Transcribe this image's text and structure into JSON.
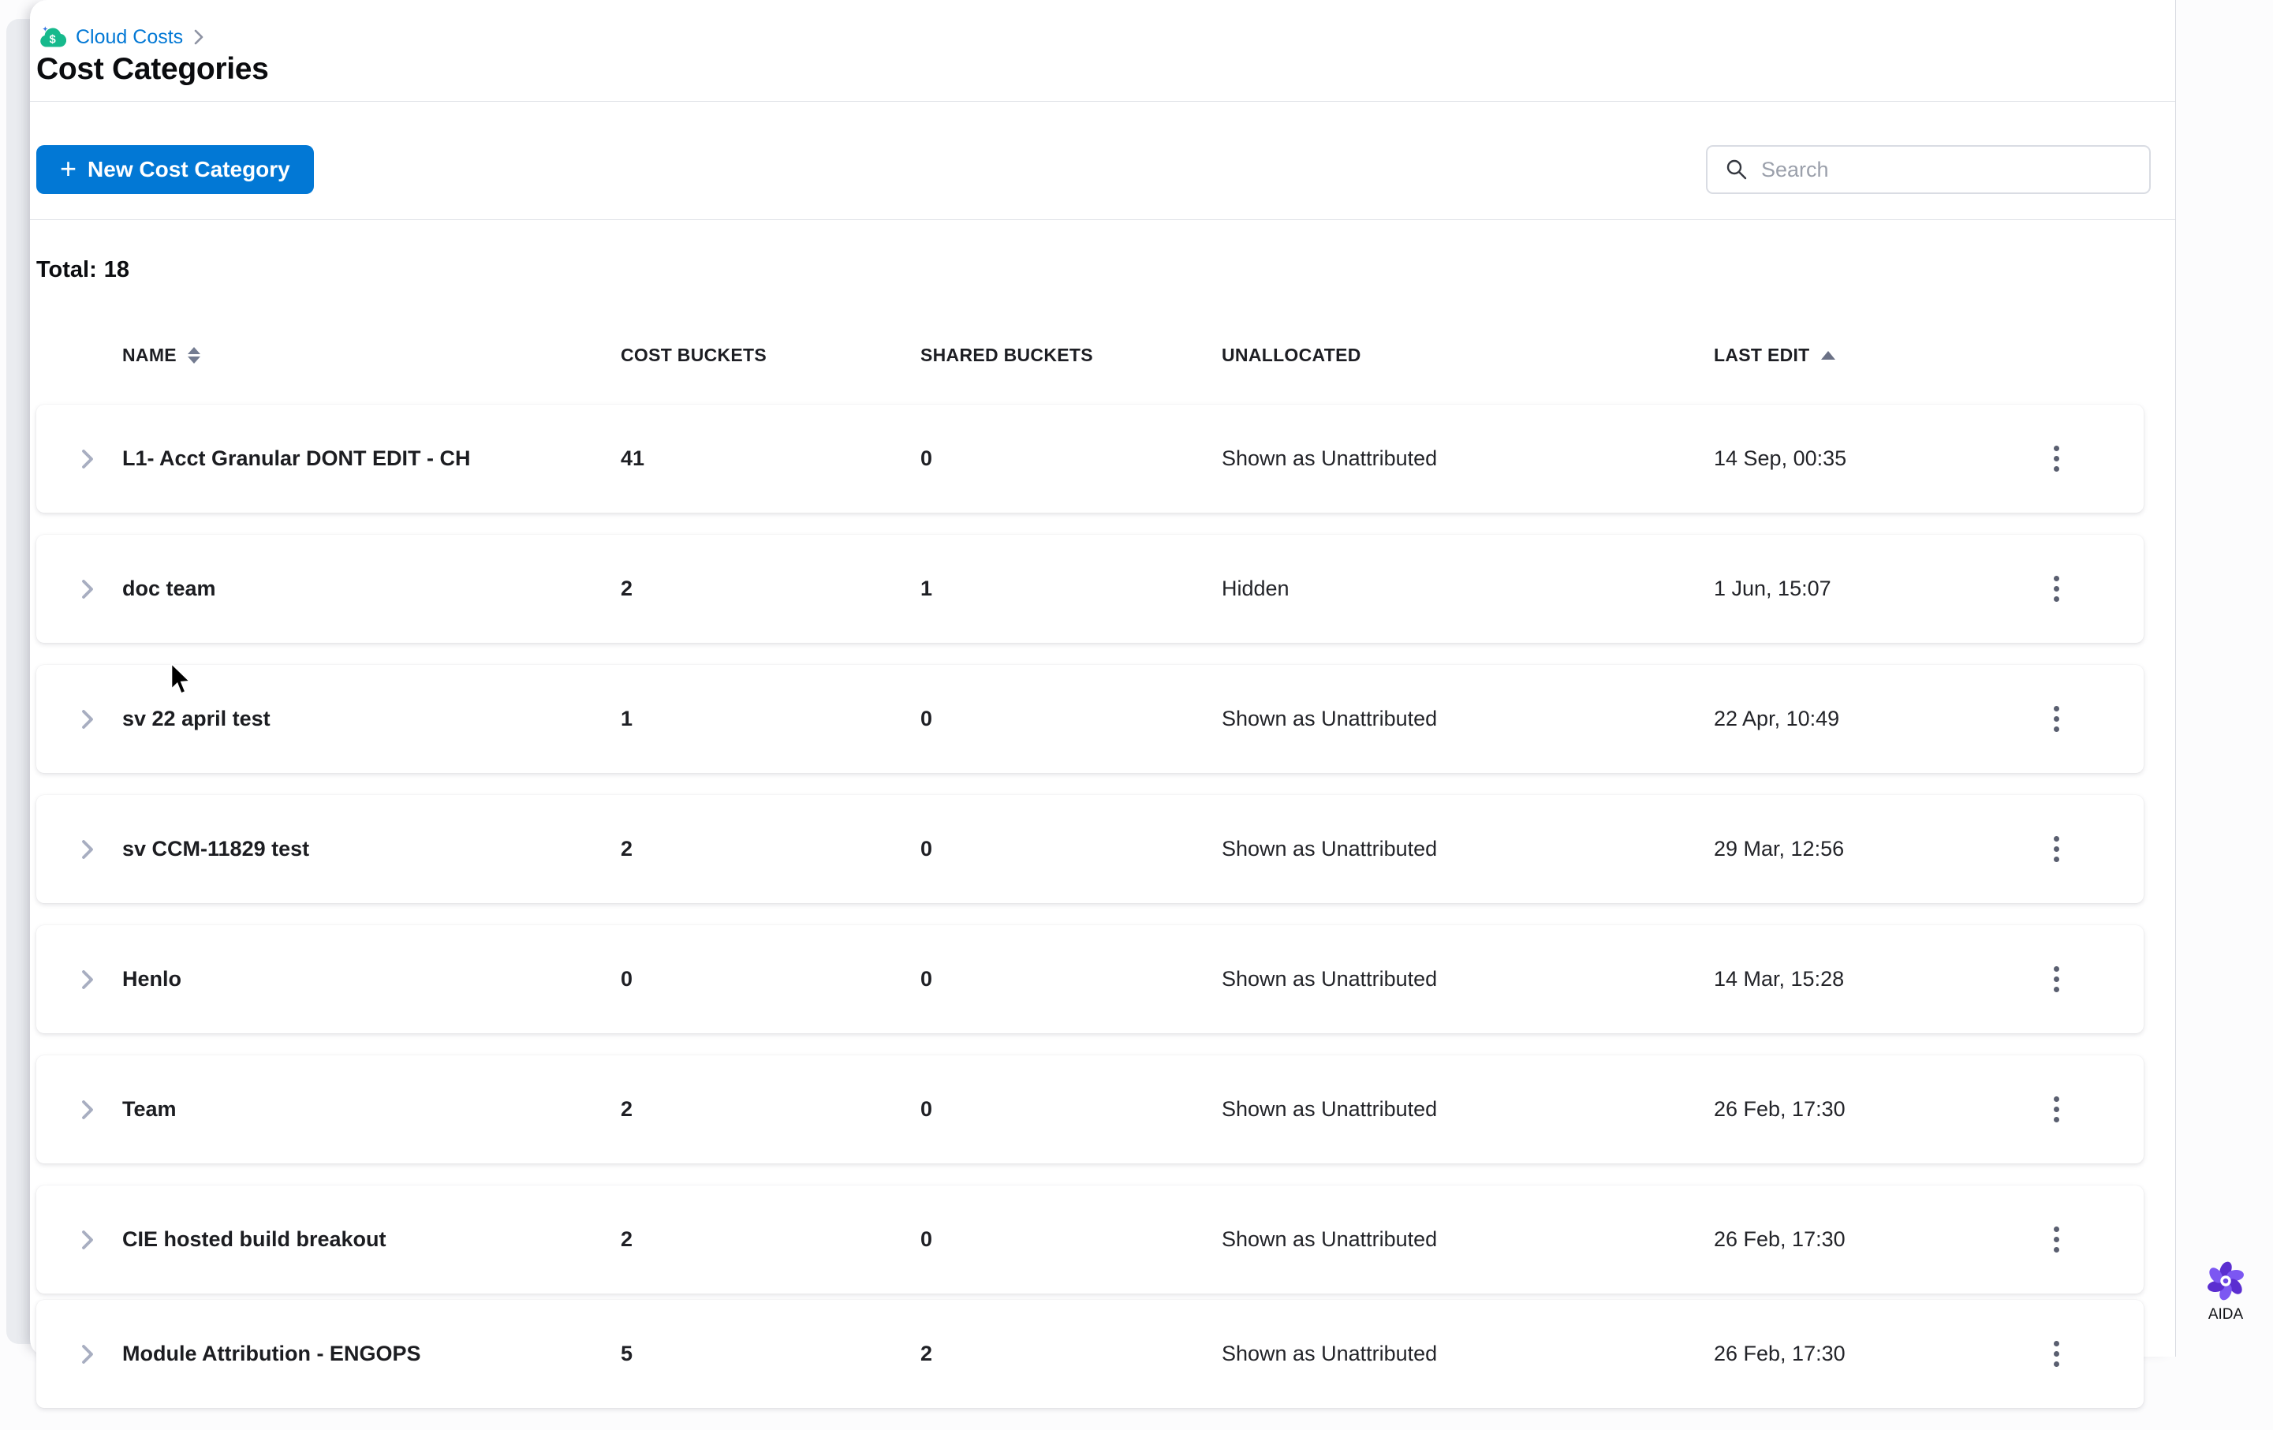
{
  "breadcrumb": {
    "module": "Cloud Costs"
  },
  "page": {
    "title": "Cost Categories",
    "total_label": "Total:",
    "total_value": "18"
  },
  "toolbar": {
    "new_button_label": "New Cost Category",
    "plus_glyph": "+",
    "search_placeholder": "Search"
  },
  "table": {
    "columns": [
      "NAME",
      "COST BUCKETS",
      "SHARED BUCKETS",
      "UNALLOCATED",
      "LAST EDIT"
    ],
    "sort": {
      "column": "LAST EDIT",
      "direction": "asc"
    },
    "rows": [
      {
        "name": "L1- Acct Granular DONT EDIT - CH",
        "cost_buckets": "41",
        "shared_buckets": "0",
        "unallocated": "Shown as Unattributed",
        "last_edit": "14 Sep, 00:35"
      },
      {
        "name": "doc team",
        "cost_buckets": "2",
        "shared_buckets": "1",
        "unallocated": "Hidden",
        "last_edit": "1 Jun, 15:07"
      },
      {
        "name": "sv 22 april test",
        "cost_buckets": "1",
        "shared_buckets": "0",
        "unallocated": "Shown as Unattributed",
        "last_edit": "22 Apr, 10:49"
      },
      {
        "name": "sv CCM-11829 test",
        "cost_buckets": "2",
        "shared_buckets": "0",
        "unallocated": "Shown as Unattributed",
        "last_edit": "29 Mar, 12:56"
      },
      {
        "name": "Henlo",
        "cost_buckets": "0",
        "shared_buckets": "0",
        "unallocated": "Shown as Unattributed",
        "last_edit": "14 Mar, 15:28"
      },
      {
        "name": "Team",
        "cost_buckets": "2",
        "shared_buckets": "0",
        "unallocated": "Shown as Unattributed",
        "last_edit": "26 Feb, 17:30"
      },
      {
        "name": "CIE hosted build breakout",
        "cost_buckets": "2",
        "shared_buckets": "0",
        "unallocated": "Shown as Unattributed",
        "last_edit": "26 Feb, 17:30"
      },
      {
        "name": "Module Attribution - ENGOPS",
        "cost_buckets": "5",
        "shared_buckets": "2",
        "unallocated": "Shown as Unattributed",
        "last_edit": "26 Feb, 17:30"
      }
    ]
  },
  "assistant": {
    "label": "AIDA"
  },
  "colors": {
    "primary_blue": "#0278d5",
    "module_teal": "#16b98c",
    "aida_purple": "#6b46e5",
    "panel_border": "#d8dbe1"
  },
  "icons": {
    "breadcrumb_module": "cloud-dollar-icon",
    "search": "magnifier-icon",
    "row_expand": "chevron-right-icon",
    "row_menu": "kebab-menu-icon",
    "name_sort": "sort-both-icon",
    "last_edit_sort": "sort-asc-icon",
    "assistant": "pinwheel-flower-icon"
  }
}
